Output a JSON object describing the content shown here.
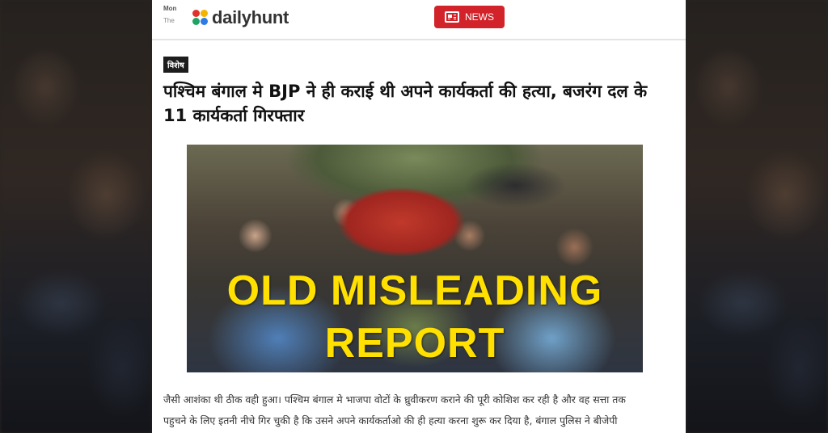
{
  "topbar": {
    "hint_line1": "Mon",
    "hint_line2": "The",
    "logo_text": "dailyhunt",
    "news_button_label": "NEWS"
  },
  "article": {
    "tag": "विशेष",
    "headline": "पश्चिम बंगाल मे BJP ने ही कराई थी अपने कार्यकर्ता की हत्या, बजरंग दल के 11 कार्यकर्ता गिरफ्तार",
    "image_overlay_line1": "OLD MISLEADING",
    "image_overlay_line2": "REPORT",
    "body_line1": "जैसी आशंका थी ठीक वही हुआ। पश्चिम बंगाल मे भाजपा वोटों के ध्रुवीकरण कराने की पूरी कोशिश कर रही है और वह सत्ता तक",
    "body_line2": "पहुचने के लिए इतनी नीचे गिर चुकी है कि उसने अपने कार्यकर्ताओ की ही हत्या करना शुरू कर दिया है, बंगाल पुलिस ने बीजेपी"
  },
  "colors": {
    "news_button": "#d2232a",
    "overlay_text": "#ffe000",
    "tag_bg": "#1d1d1d"
  },
  "icons": {
    "logo": "dailyhunt-logo-icon",
    "news": "newspaper-icon"
  }
}
